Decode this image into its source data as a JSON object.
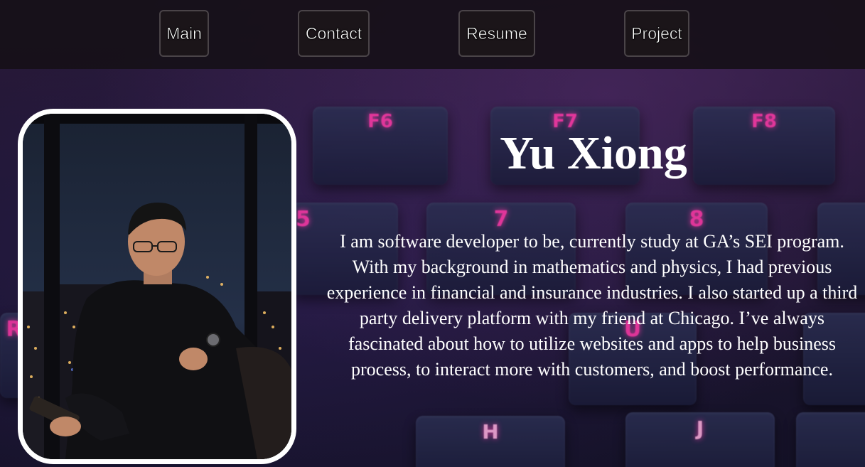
{
  "nav": {
    "items": [
      {
        "label": "Main"
      },
      {
        "label": "Contact"
      },
      {
        "label": "Resume"
      },
      {
        "label": "Project"
      }
    ]
  },
  "hero": {
    "name": "Yu Xiong",
    "bio": "I am software developer to be, currently study at GA’s SEI program. With my background in mathematics and physics, I had previous experience in financial and insurance industries. I also started up a third party delivery platform with my friend at Chicago. I’ve always fascinated about how to utilize websites and apps to help business process, to interact more with customers, and boost performance."
  },
  "background": {
    "key_labels": [
      "F6",
      "F7",
      "F8",
      "7",
      "8",
      "5",
      "U",
      "R",
      "H",
      "J"
    ]
  },
  "colors": {
    "accent_pink": "#ff3aa8",
    "nav_bg": "#161018",
    "text": "#ffffff"
  }
}
